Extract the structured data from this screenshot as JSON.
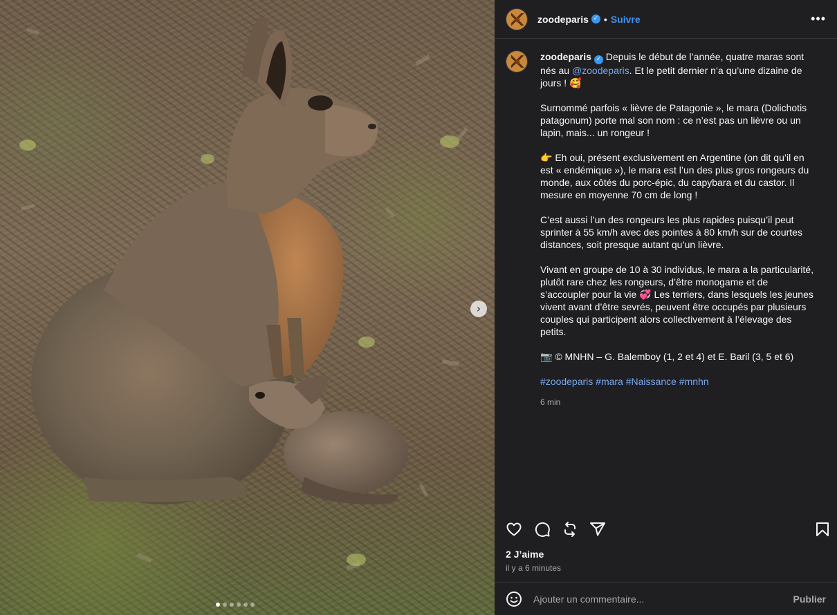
{
  "header": {
    "username": "zoodeparis",
    "verified_badge": "✓",
    "separator": "•",
    "follow_label": "Suivre",
    "more_icon": "more-horizontal-icon",
    "more_label": "•••"
  },
  "photo": {
    "description_icon": "photo-mara-with-baby",
    "next_label": "›",
    "carousel_count": 6,
    "carousel_active": 1
  },
  "caption": {
    "username": "zoodeparis",
    "intro_a": " Depuis le début de l’année, quatre maras sont nés au ",
    "mention": "@zoodeparis",
    "intro_b": ". Et le petit dernier n’a qu’une dizaine de jours ! 🥰",
    "p2": "Surnommé parfois « lièvre de Patagonie », le mara (Dolichotis patagonum) porte mal son nom : ce n’est pas un lièvre ou un lapin, mais... un rongeur !",
    "p3": "👉 Eh oui, présent exclusivement en Argentine (on dit qu’il en est « endémique »), le mara est l’un des plus gros rongeurs du monde, aux côtés du porc-épic, du capybara et du castor. Il mesure en moyenne 70 cm de long !",
    "p4": "C’est aussi l’un des rongeurs les plus rapides puisqu’il peut sprinter à 55 km/h avec des pointes à 80 km/h sur de courtes distances, soit presque autant qu’un lièvre.",
    "p5": "Vivant en groupe de 10 à 30 individus, le mara a la particularité, plutôt rare chez les rongeurs, d’être monogame et de s’accoupler pour la vie 💞 Les terriers, dans lesquels les jeunes vivent avant d’être sevrés, peuvent être occupés par plusieurs couples qui participent alors collectivement à l’élevage des petits.",
    "p6": "📷 © MNHN – G. Balemboy (1, 2 et 4) et E. Baril (3, 5 et 6)",
    "hashtags": "#zoodeparis #mara #Naissance #mnhn",
    "time": "6 min"
  },
  "actions": {
    "like_icon": "heart-icon",
    "comment_icon": "comment-icon",
    "repost_icon": "repost-icon",
    "share_icon": "share-icon",
    "save_icon": "bookmark-icon"
  },
  "stats": {
    "likes": "2 J’aime",
    "posted_ago": "il y a 6 minutes"
  },
  "comment_bar": {
    "emoji_icon": "emoji-icon",
    "placeholder": "Ajouter un commentaire...",
    "publish_label": "Publier"
  },
  "colors": {
    "panel_bg": "#1f1f22",
    "link": "#4193ef",
    "mention": "#7aa7ee",
    "muted": "#a8a8a8"
  }
}
